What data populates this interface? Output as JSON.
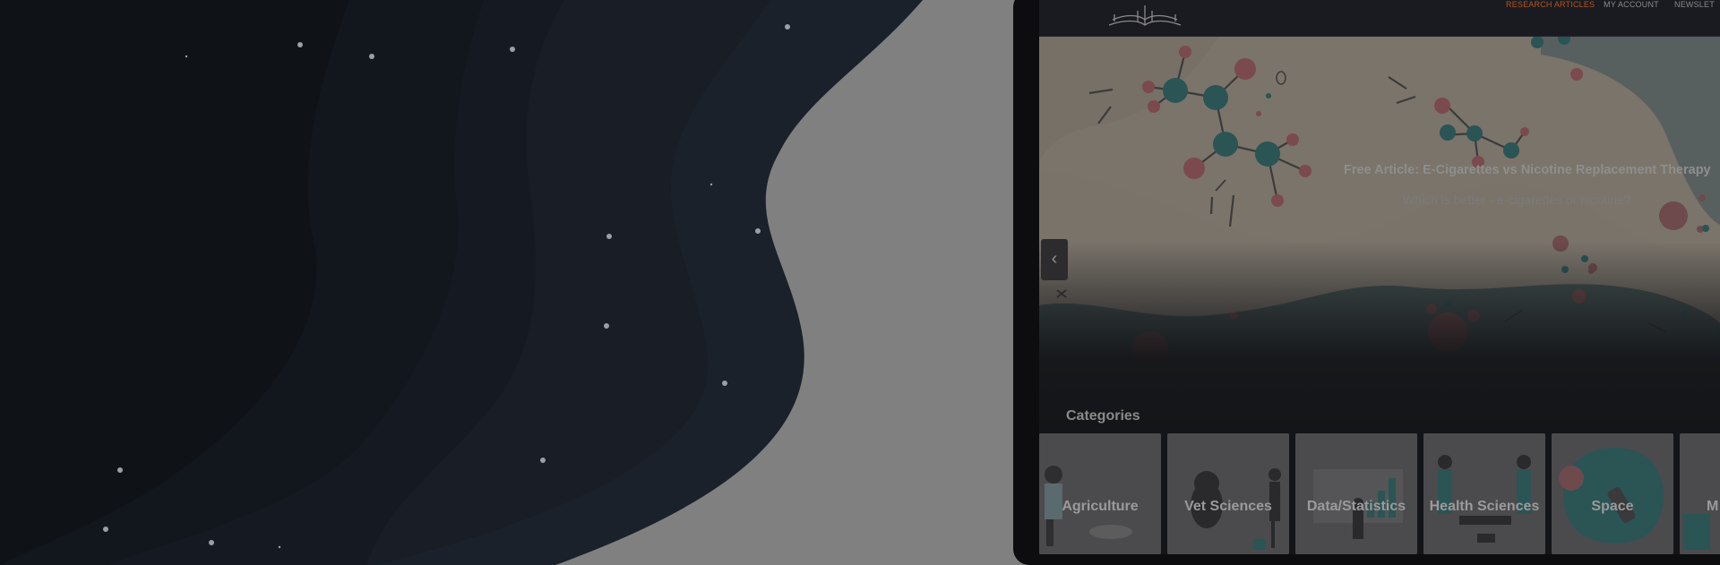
{
  "colors": {
    "page_background": "#808080",
    "space_dark": "#0f1217",
    "accent_nav": "#b5561e",
    "hero_cream": "#79736a",
    "teal_molecule": "#2b5455",
    "red_molecule": "#7b4a4e"
  },
  "site": {
    "logo_icon": "open-book-icon",
    "nav": {
      "research_articles": "RESEARCH ARTICLES",
      "my_account": "MY ACCOUNT",
      "newsletter": "NEWSLET"
    }
  },
  "hero": {
    "title": "Free Article: E-Cigarettes vs Nicotine Replacement Therapy",
    "subtitle": "Which is better - e-cigarettes or nicotine?",
    "prev_icon": "‹"
  },
  "categories": {
    "heading": "Categories",
    "items": [
      {
        "label": "Agriculture"
      },
      {
        "label": "Vet Sciences"
      },
      {
        "label": "Data/Statistics"
      },
      {
        "label": "Health Sciences"
      },
      {
        "label": "Space"
      },
      {
        "label": "M"
      }
    ]
  }
}
